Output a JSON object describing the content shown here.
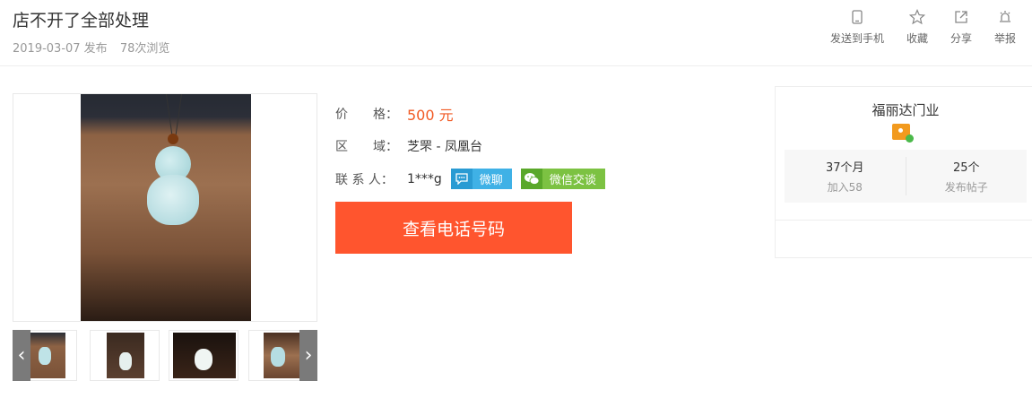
{
  "header": {
    "title": "店不开了全部处理",
    "date": "2019-03-07 发布",
    "views": "78次浏览"
  },
  "actions": [
    {
      "label": "发送到手机",
      "icon": "phone-icon"
    },
    {
      "label": "收藏",
      "icon": "star-icon"
    },
    {
      "label": "分享",
      "icon": "share-icon"
    },
    {
      "label": "举报",
      "icon": "alarm-icon"
    }
  ],
  "details": {
    "price_label": "价　　格：",
    "price_value": "500 元",
    "region_label": "区　　域：",
    "region_value": "芝罘 - 凤凰台",
    "contact_label": "联 系 人：",
    "contact_value": "1***g",
    "weiliao_label": "微聊",
    "wechat_label": "微信交谈",
    "phone_button": "查看电话号码"
  },
  "shop": {
    "name": "福丽达门业",
    "stats": [
      {
        "value": "37个月",
        "label": "加入58"
      },
      {
        "value": "25个",
        "label": "发布帖子"
      }
    ]
  },
  "colors": {
    "accent": "#ff552e",
    "price": "#f15a24",
    "weiliao": "#3fb1e6",
    "wechat": "#7cc242"
  }
}
